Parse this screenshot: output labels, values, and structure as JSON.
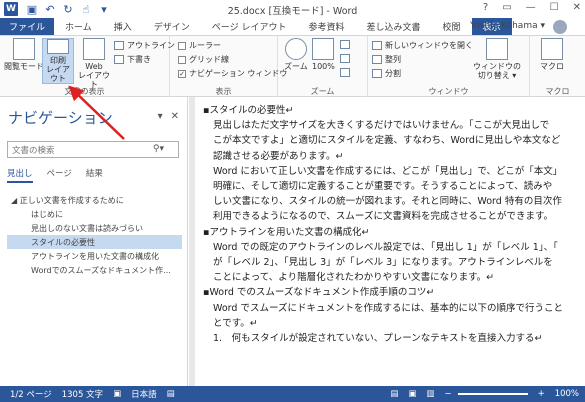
{
  "titlebar": {
    "logo": "W",
    "title": "25.docx [互換モード] - Word",
    "controls": [
      "?",
      "▭",
      "—",
      "☐",
      "✕"
    ]
  },
  "tabs": [
    "ファイル",
    "ホーム",
    "挿入",
    "デザイン",
    "ページ レイアウト",
    "参考資料",
    "差し込み文書",
    "校閲",
    "表示"
  ],
  "user_name": "Yoshie Kohama ▾",
  "ribbon": {
    "views": {
      "read_mode": "閲覧モード",
      "print_layout_1": "印刷",
      "print_layout_2": "レイアウト",
      "web_layout_1": "Web",
      "web_layout_2": "レイアウト",
      "outline": "アウトライン",
      "draft": "下書き",
      "group_label": "文書の表示"
    },
    "show": {
      "ruler": "ルーラー",
      "gridlines": "グリッド線",
      "nav_pane": "ナビゲーション ウィンドウ",
      "group_label": "表示"
    },
    "zoom": {
      "zoom": "ズーム",
      "pct": "100%",
      "group_label": "ズーム"
    },
    "window": {
      "new_window": "新しいウィンドウを開く",
      "arrange": "整列",
      "split": "分割",
      "switch_1": "ウィンドウの",
      "switch_2": "切り替え ▾",
      "group_label": "ウィンドウ"
    },
    "macro": {
      "macro": "マクロ",
      "group_label": "マクロ"
    }
  },
  "nav": {
    "title": "ナビゲーション",
    "search_placeholder": "文書の検索",
    "tabs": [
      "見出し",
      "ページ",
      "結果"
    ],
    "tree": [
      "◢ 正しい文書を作成するために",
      "はじめに",
      "見出しのない文書は読みづらい",
      "スタイルの必要性",
      "アウトラインを用いた文書の構成化",
      "Wordでのスムーズなドキュメント作..."
    ]
  },
  "document": {
    "lines": [
      "▪スタイルの必要性↵",
      "見出しはただ文字サイズを大きくするだけではいけません。「ここが大見出しで",
      "こが本文ですよ」と適切にスタイルを定義、すなわち、Wordに見出しや本文など",
      "認識させる必要があります。↵",
      "Word において正しい文書を作成するには、どこが「見出し」で、どこが「本文」",
      "明確に、そして適切に定義することが重要です。そうすることによって、読みや",
      "しい文書になり、スタイルの統一が図れます。それと同時に、Word 特有の目次作",
      "利用できるようになるので、スムーズに文書資料を完成させることができます。",
      "▪アウトラインを用いた文書の構成化↵",
      "Word での既定のアウトラインのレベル設定では、「見出し 1」が「レベル 1」、「",
      "が「レベル 2」、「見出し 3」が「レベル 3」になります。アウトラインレベルを",
      "ことによって、より階層化されたわかりやすい文書になります。↵",
      "▪Word でのスムーズなドキュメント作成手順のコツ↵",
      "Word でスムーズにドキュメントを作成するには、基本的に以下の順序で行うこと",
      "とです。↵",
      "1.　何もスタイルが設定されていない、プレーンなテキストを直接入力する↵"
    ]
  },
  "status": {
    "page": "1/2 ページ",
    "words": "1305 文字",
    "lang": "日本語",
    "zoom": "100%"
  }
}
